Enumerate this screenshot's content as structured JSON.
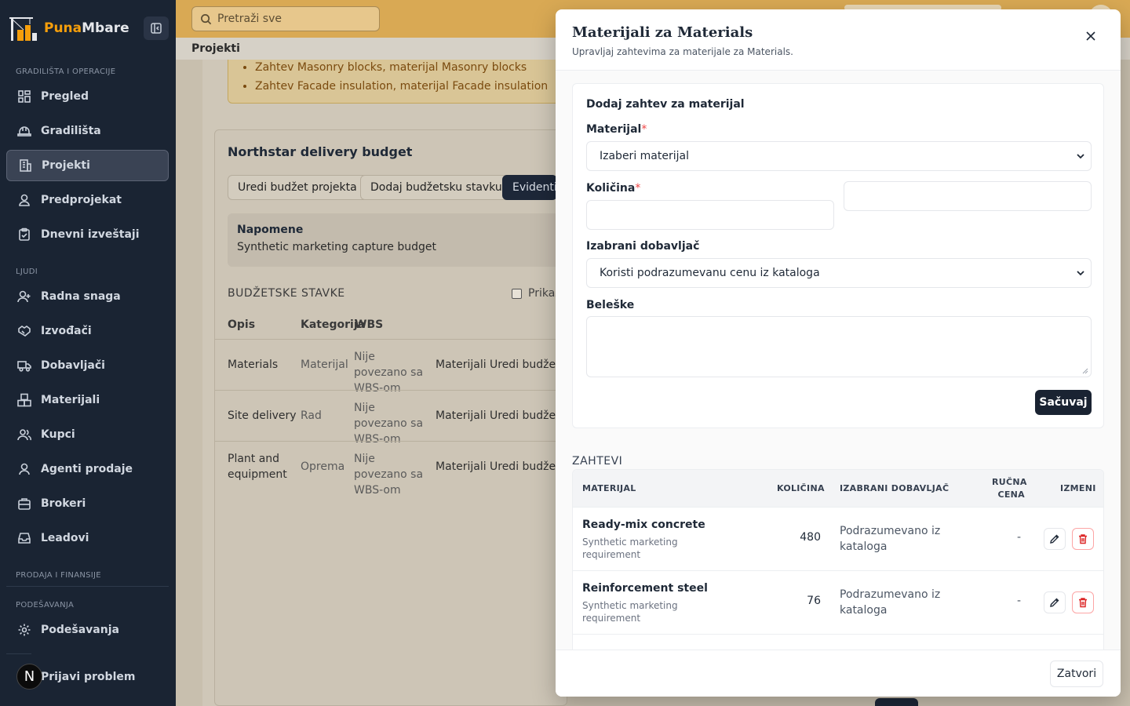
{
  "app": {
    "brand_part1": "Puna",
    "brand_part2": "Mbare"
  },
  "sidebar": {
    "sections": [
      "GRADILIŠTA I OPERACIJE",
      "LJUDI",
      "PRODAJA I FINANSIJE",
      "PODEŠAVANJA"
    ],
    "items": [
      {
        "label": "Pregled",
        "icon": "dashboard-icon"
      },
      {
        "label": "Gradilišta",
        "icon": "helmet-icon"
      },
      {
        "label": "Projekti",
        "icon": "building-icon",
        "active": true
      },
      {
        "label": "Predprojekat",
        "icon": "user-icon"
      },
      {
        "label": "Dnevni izveštaji",
        "icon": "clipboard-icon"
      },
      {
        "label": "Radna snaga",
        "icon": "user-plus-icon"
      },
      {
        "label": "Izvođači",
        "icon": "handshake-icon"
      },
      {
        "label": "Dobavljači",
        "icon": "truck-icon"
      },
      {
        "label": "Materijali",
        "icon": "boxes-icon"
      },
      {
        "label": "Kupci",
        "icon": "users-icon"
      },
      {
        "label": "Agenti prodaje",
        "icon": "user-round-icon"
      },
      {
        "label": "Brokeri",
        "icon": "briefcase-icon"
      },
      {
        "label": "Leadovi",
        "icon": "inbox-icon"
      },
      {
        "label": "Podešavanja",
        "icon": "gear-icon"
      }
    ],
    "avatar_letter": "N",
    "report_problem": "Prijavi problem"
  },
  "header": {
    "search_placeholder": "Pretraži sve",
    "breadcrumb": "Projekti"
  },
  "background": {
    "warnings": [
      "Zahtev Masonry blocks, materijal Masonry blocks",
      "Zahtev Facade insulation, materijal Facade insulation"
    ],
    "budget_title": "Northstar delivery budget",
    "buttons": [
      "Uredi budžet projekta",
      "Dodaj budžetsku stavku",
      "Evidentir"
    ],
    "notes_title": "Napomene",
    "notes_text": "Synthetic marketing capture budget",
    "stavke_label": "BUDŽETSKE STAVKE",
    "prikaz_label": "Prikaz",
    "columns": [
      "Opis",
      "Kategorija",
      "WBS"
    ],
    "rows": [
      {
        "opis": "Materials",
        "kategorija": "Materijal",
        "wbs": "Nije povezano sa WBS-om",
        "extra": "Materijali",
        "action": "Uredi budžets"
      },
      {
        "opis": "Site delivery",
        "kategorija": "Rad",
        "wbs": "Nije povezano sa WBS-om",
        "extra": "Materijali",
        "action": "Uredi budžets"
      },
      {
        "opis": "Plant and equipment",
        "kategorija": "Oprema",
        "wbs": "Nije povezano sa WBS-om",
        "extra": "Materijali",
        "action": "Uredi budžets"
      }
    ]
  },
  "modal": {
    "title": "Materijali za Materials",
    "subtitle": "Upravljaj zahtevima za materijale za Materials.",
    "form_heading": "Dodaj zahtev za materijal",
    "material_label": "Materijal",
    "material_value": "Izaberi materijal",
    "quantity_label": "Količina",
    "supplier_label": "Izabrani dobavljač",
    "supplier_value": "Koristi podrazumevanu cenu iz kataloga",
    "notes_label": "Beleške",
    "save_label": "Sačuvaj",
    "requests_label": "ZAHTEVI",
    "table_headers": {
      "material": "MATERIJAL",
      "quantity": "KOLIČINA",
      "supplier": "IZABRANI DOBAVLJAČ",
      "price_line1": "RUČNA",
      "price_line2": "CENA",
      "edit": "IZMENI"
    },
    "requests": [
      {
        "name": "Ready-mix concrete",
        "desc": "Synthetic marketing requirement",
        "qty": "480",
        "supplier": "Podrazumevano iz kataloga",
        "price": "-"
      },
      {
        "name": "Reinforcement steel",
        "desc": "Synthetic marketing requirement",
        "qty": "76",
        "supplier": "Podrazumevano iz kataloga",
        "price": "-"
      }
    ],
    "close_footer": "Zatvori"
  }
}
